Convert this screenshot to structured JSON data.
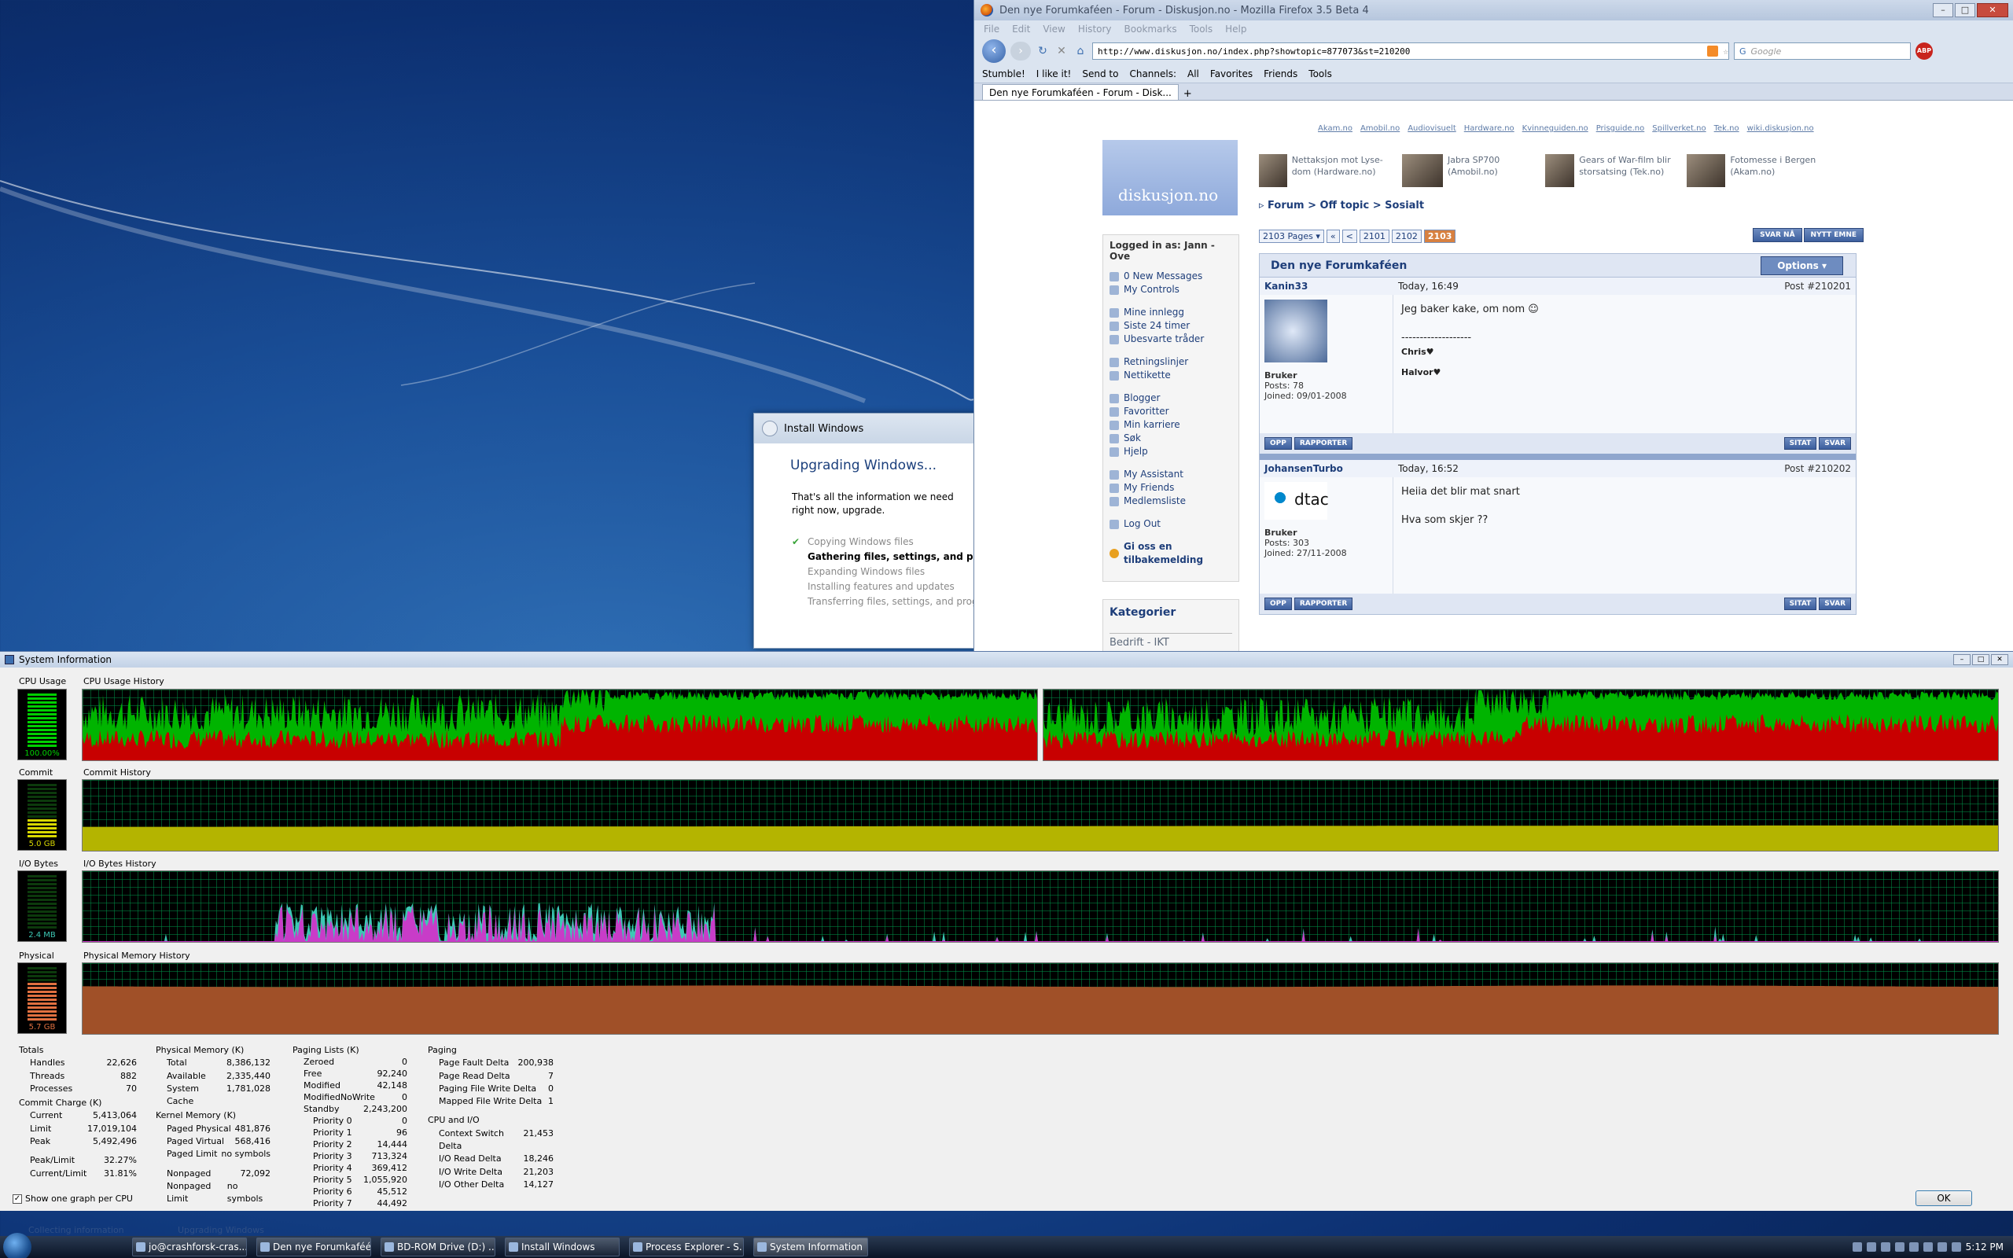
{
  "install": {
    "title": "Install Windows",
    "heading": "Upgrading Windows...",
    "desc": "That's all the information we need right now, upgrade.",
    "steps": [
      "Copying Windows files",
      "Gathering files, settings, and programs",
      "Expanding Windows files",
      "Installing features and updates",
      "Transferring files, settings, and programs"
    ]
  },
  "firefox": {
    "title": "Den nye Forumkaféen - Forum - Diskusjon.no - Mozilla Firefox 3.5 Beta 4",
    "menu": [
      "File",
      "Edit",
      "View",
      "History",
      "Bookmarks",
      "Tools",
      "Help"
    ],
    "url": "http://www.diskusjon.no/index.php?showtopic=877073&st=210200",
    "search_placeholder": "Google",
    "abp": "ABP",
    "toolbar2": [
      "Stumble!",
      "I like it!",
      "Send to",
      "Channels:",
      "All",
      "Favorites",
      "Friends",
      "Tools"
    ],
    "tab": "Den nye Forumkaféen - Forum - Disk...",
    "toplinks": [
      "Akam.no",
      "Amobil.no",
      "Audiovisuelt",
      "Hardware.no",
      "Kvinneguiden.no",
      "Prisguide.no",
      "Spillverket.no",
      "Tek.no",
      "wiki.diskusjon.no"
    ],
    "logo": "diskusjon.no",
    "news": [
      {
        "text": "Nettaksjon mot Lyse-dom (Hardware.no)"
      },
      {
        "text": "Jabra SP700 (Amobil.no)"
      },
      {
        "text": "Gears of War-film blir storsatsing (Tek.no)"
      },
      {
        "text": "Fotomesse i Bergen (Akam.no)"
      }
    ],
    "breadcrumb": "▹ Forum > Off topic > Sosialt",
    "pages_label": "2103 Pages ▾",
    "pages": [
      "«",
      "<",
      "2101",
      "2102",
      "2103"
    ],
    "btn_reply": "SVAR NÅ",
    "btn_new": "NYTT EMNE",
    "logged_in": "Logged in as: Jann - Ove",
    "side": [
      [
        "0 New Messages",
        "My Controls"
      ],
      [
        "Mine innlegg",
        "Siste 24 timer",
        "Ubesvarte tråder"
      ],
      [
        "Retningslinjer",
        "Nettikette"
      ],
      [
        "Blogger",
        "Favoritter",
        "Min karriere",
        "Søk",
        "Hjelp"
      ],
      [
        "My Assistant",
        "My Friends",
        "Medlemsliste"
      ],
      [
        "Log Out"
      ],
      [
        "Gi oss en tilbakemelding"
      ]
    ],
    "kategorier": "Kategorier",
    "kat_item": "Bedrift - IKT",
    "thread_title": "Den nye Forumkaféen",
    "options": "Options ▾",
    "posts": [
      {
        "user": "Kanin33",
        "time": "Today, 16:49",
        "num": "Post #210201",
        "rank": "Bruker",
        "posts": "Posts: 78",
        "joined": "Joined: 09/01-2008",
        "lines": [
          "Jeg baker kake, om nom ☺",
          "",
          "-------------------",
          "Chris♥",
          "Halvor♥"
        ]
      },
      {
        "user": "JohansenTurbo",
        "time": "Today, 16:52",
        "num": "Post #210202",
        "rank": "Bruker",
        "posts": "Posts: 303",
        "joined": "Joined: 27/11-2008",
        "avatar_text": "dtac",
        "lines": [
          "Heiia det blir mat snart",
          "",
          "Hva som skjer ??"
        ]
      }
    ],
    "post_btns": [
      "OPP",
      "RAPPORTER",
      "SITAT",
      "SVAR"
    ]
  },
  "sysinfo": {
    "title": "System Information",
    "labels": {
      "cpu": "CPU Usage",
      "cpu_hist": "CPU Usage History",
      "commit": "Commit",
      "commit_hist": "Commit History",
      "io": "I/O Bytes",
      "io_hist": "I/O Bytes History",
      "phys": "Physical",
      "phys_hist": "Physical Memory History"
    },
    "meters": {
      "cpu": "100.00%",
      "commit": "5.0 GB",
      "io": "2.4 MB",
      "phys": "5.7 GB"
    },
    "meter_levels": {
      "cpu": 1.0,
      "commit": 0.33,
      "io": 0.0,
      "phys": 0.68
    },
    "totals": {
      "title": "Totals",
      "rows": [
        [
          "Handles",
          "22,626"
        ],
        [
          "Threads",
          "882"
        ],
        [
          "Processes",
          "70"
        ]
      ]
    },
    "commit_charge": {
      "title": "Commit Charge (K)",
      "rows": [
        [
          "Current",
          "5,413,064"
        ],
        [
          "Limit",
          "17,019,104"
        ],
        [
          "Peak",
          "5,492,496"
        ]
      ],
      "rows2": [
        [
          "Peak/Limit",
          "32.27%"
        ],
        [
          "Current/Limit",
          "31.81%"
        ]
      ]
    },
    "phys_mem": {
      "title": "Physical Memory (K)",
      "rows": [
        [
          "Total",
          "8,386,132"
        ],
        [
          "Available",
          "2,335,440"
        ],
        [
          "System Cache",
          "1,781,028"
        ]
      ]
    },
    "kernel_mem": {
      "title": "Kernel Memory (K)",
      "rows": [
        [
          "Paged Physical",
          "481,876"
        ],
        [
          "Paged Virtual",
          "568,416"
        ],
        [
          "Paged Limit",
          "no symbols"
        ]
      ],
      "rows2": [
        [
          "Nonpaged",
          "72,092"
        ],
        [
          "Nonpaged Limit",
          "no symbols"
        ]
      ]
    },
    "paging_lists": {
      "title": "Paging Lists (K)",
      "rows": [
        [
          "Zeroed",
          "0"
        ],
        [
          "Free",
          "92,240"
        ],
        [
          "Modified",
          "42,148"
        ],
        [
          "ModifiedNoWrite",
          "0"
        ],
        [
          "Standby",
          "2,243,200"
        ]
      ],
      "prio": [
        [
          "Priority 0",
          "0"
        ],
        [
          "Priority 1",
          "96"
        ],
        [
          "Priority 2",
          "14,444"
        ],
        [
          "Priority 3",
          "713,324"
        ],
        [
          "Priority 4",
          "369,412"
        ],
        [
          "Priority 5",
          "1,055,920"
        ],
        [
          "Priority 6",
          "45,512"
        ],
        [
          "Priority 7",
          "44,492"
        ]
      ]
    },
    "paging": {
      "title": "Paging",
      "rows": [
        [
          "Page Fault Delta",
          "200,938"
        ],
        [
          "Page Read Delta",
          "7"
        ],
        [
          "Paging File Write Delta",
          "0"
        ],
        [
          "Mapped File Write Delta",
          "1"
        ]
      ]
    },
    "cpu_io": {
      "title": "CPU and I/O",
      "rows": [
        [
          "Context Switch Delta",
          "21,453"
        ],
        [
          "I/O Read Delta",
          "18,246"
        ],
        [
          "I/O Write Delta",
          "21,203"
        ],
        [
          "I/O Other Delta",
          "14,127"
        ]
      ]
    },
    "show_per_cpu": "Show one graph per CPU",
    "ok": "OK"
  },
  "status": {
    "left": "Collecting information",
    "right": "Upgrading Windows"
  },
  "taskbar": {
    "items": [
      "jo@crashforsk-cras...",
      "Den nye Forumkaféé...",
      "BD-ROM Drive (D:) ...",
      "Install Windows",
      "Process Explorer - S...",
      "System Information"
    ],
    "clock": "5:12 PM"
  },
  "colors": {
    "cpu_green": "#00b400",
    "cpu_red": "#c80000",
    "commit_yellow": "#b4b400",
    "io_cyan": "#3cc8b4",
    "io_magenta": "#c83cc8",
    "phys_brown": "#a05028"
  }
}
